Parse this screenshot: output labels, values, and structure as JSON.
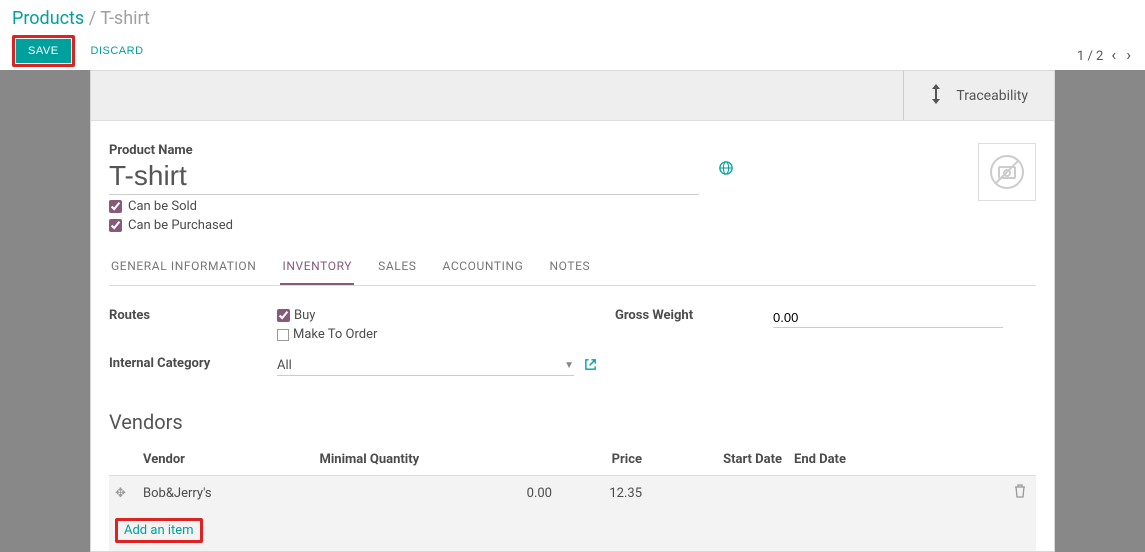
{
  "header": {
    "breadcrumb_root": "Products",
    "breadcrumb_current": "T-shirt",
    "save_label": "SAVE",
    "discard_label": "DISCARD",
    "pager_text": "1 / 2"
  },
  "sheet_header": {
    "traceability_label": "Traceability"
  },
  "product": {
    "name_label": "Product Name",
    "name_value": "T-shirt",
    "can_be_sold_label": "Can be Sold",
    "can_be_purchased_label": "Can be Purchased",
    "image_placeholder_icon": "camera-slash-icon"
  },
  "tabs": [
    {
      "label": "GENERAL INFORMATION",
      "key": "general"
    },
    {
      "label": "INVENTORY",
      "key": "inventory"
    },
    {
      "label": "SALES",
      "key": "sales"
    },
    {
      "label": "ACCOUNTING",
      "key": "accounting"
    },
    {
      "label": "NOTES",
      "key": "notes"
    }
  ],
  "active_tab": "inventory",
  "inventory": {
    "routes_label": "Routes",
    "route_buy_label": "Buy",
    "route_mto_label": "Make To Order",
    "internal_category_label": "Internal Category",
    "internal_category_value": "All",
    "gross_weight_label": "Gross Weight",
    "gross_weight_value": "0.00"
  },
  "vendors": {
    "section_title": "Vendors",
    "columns": {
      "vendor": "Vendor",
      "min_qty": "Minimal Quantity",
      "price": "Price",
      "start_date": "Start Date",
      "end_date": "End Date"
    },
    "rows": [
      {
        "vendor": "Bob&Jerry's",
        "min_qty": "0.00",
        "price": "12.35",
        "start_date": "",
        "end_date": ""
      }
    ],
    "add_item_label": "Add an item"
  },
  "icons": {
    "updown": "updown-icon",
    "globe": "globe-icon",
    "external": "external-link-icon",
    "drag": "drag-icon",
    "trash": "trash-icon"
  }
}
